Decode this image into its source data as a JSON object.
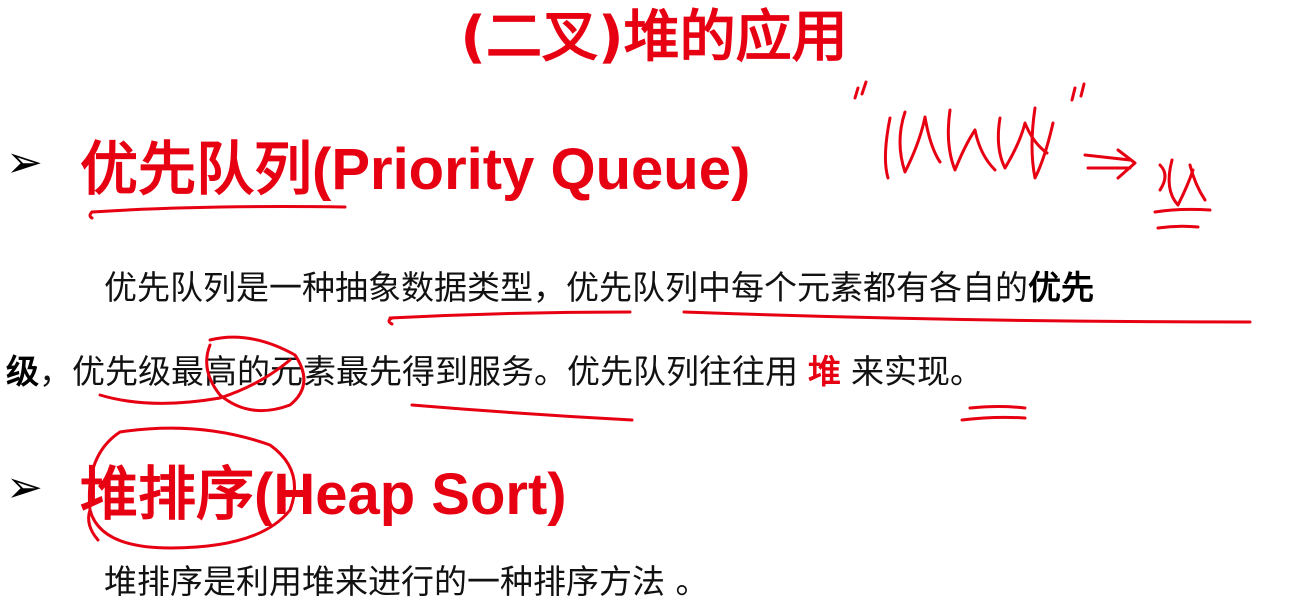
{
  "slide": {
    "title": "(二叉)堆的应用",
    "sections": [
      {
        "bullet": "➢",
        "heading": "优先队列(Priority Queue)",
        "paragraph": {
          "line1_a": "优先队列是一种抽象数据类型，优先队列中每个元素都有各自的",
          "line1_bold": "优先",
          "line2_bold": "级",
          "line2_a": "，优先级最高的元素最先得到服务。优先队列往往用",
          "line2_red": "堆",
          "line2_b": "来实现。"
        }
      },
      {
        "bullet": "➢",
        "heading": "堆排序(Heap Sort)",
        "paragraph": {
          "line1": "堆排序是利用堆来进行的一种排序方法 。"
        }
      }
    ]
  },
  "colors": {
    "accent_red": "#e60012",
    "text": "#111111"
  }
}
